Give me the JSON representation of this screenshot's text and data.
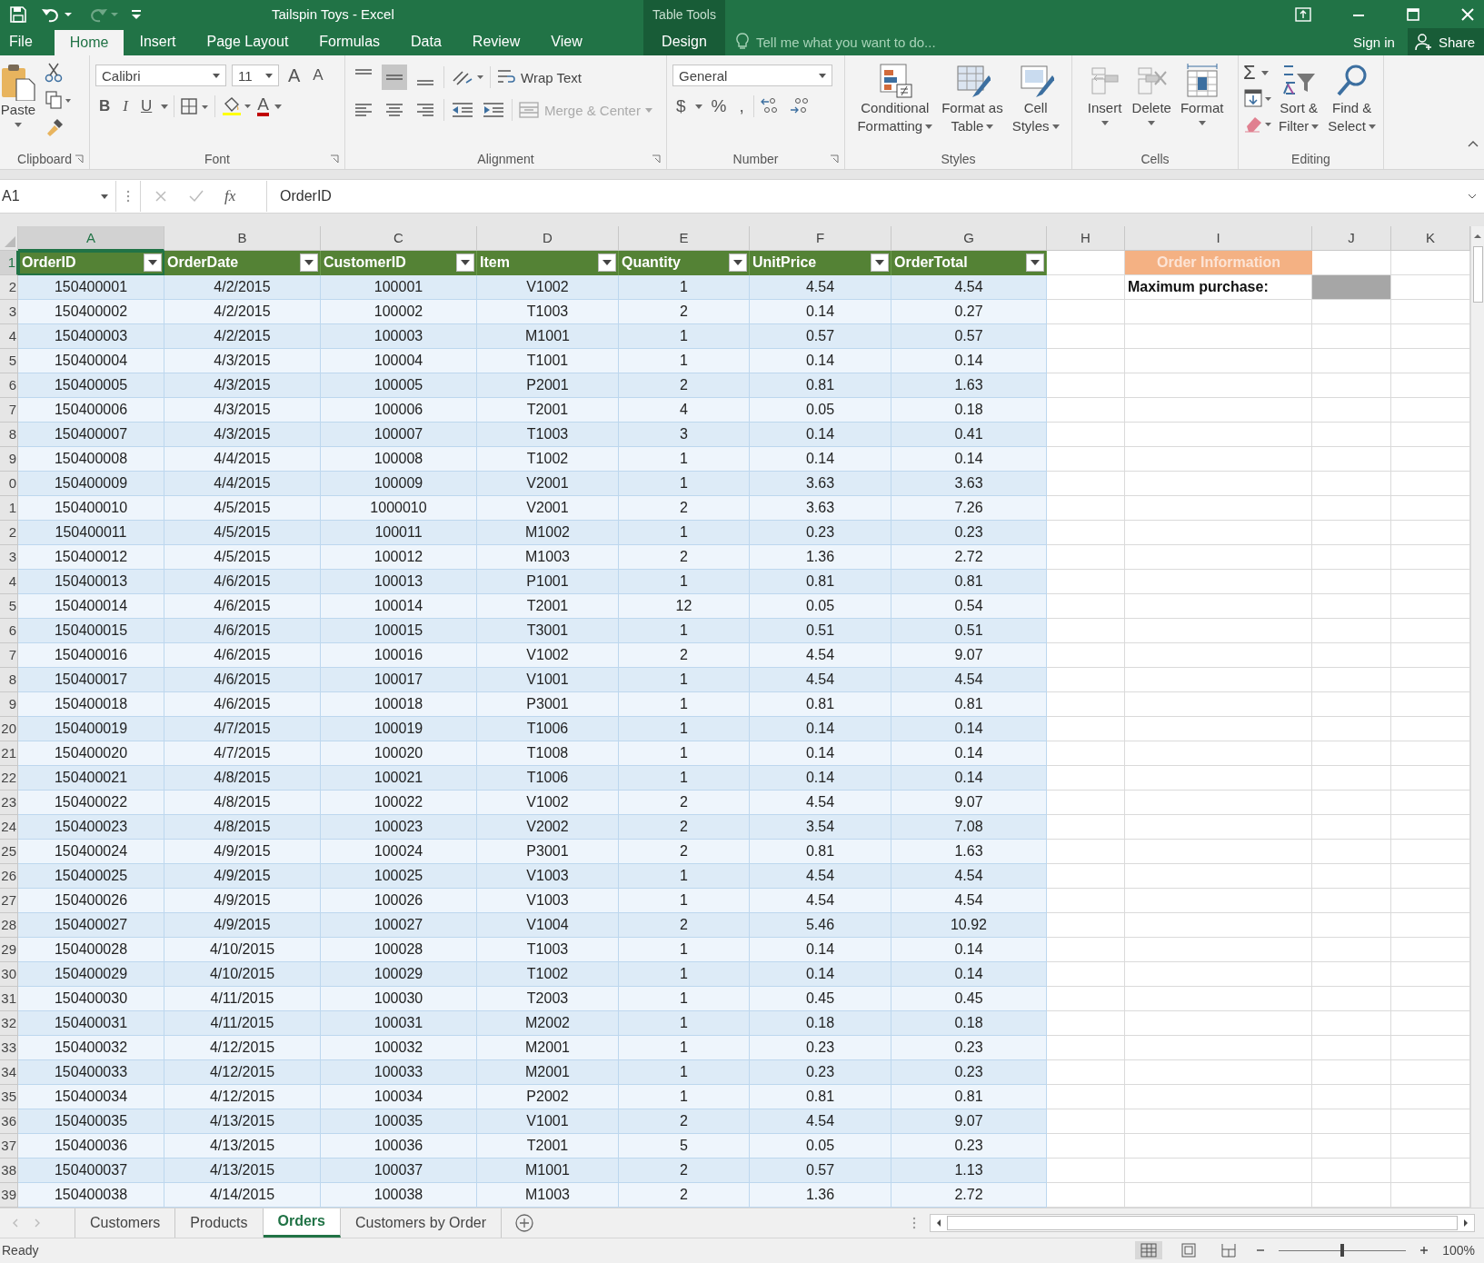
{
  "window": {
    "title": "Tailspin Toys - Excel",
    "contextual_group": "Table Tools"
  },
  "ribbon_tabs": [
    {
      "label": "File",
      "selected": false,
      "kind": "file"
    },
    {
      "label": "Home",
      "selected": true,
      "kind": "normal"
    },
    {
      "label": "Insert",
      "selected": false,
      "kind": "normal"
    },
    {
      "label": "Page Layout",
      "selected": false,
      "kind": "normal"
    },
    {
      "label": "Formulas",
      "selected": false,
      "kind": "normal"
    },
    {
      "label": "Data",
      "selected": false,
      "kind": "normal"
    },
    {
      "label": "Review",
      "selected": false,
      "kind": "normal"
    },
    {
      "label": "View",
      "selected": false,
      "kind": "normal"
    },
    {
      "label": "Design",
      "selected": false,
      "kind": "contextual"
    }
  ],
  "tell_me": {
    "placeholder": "Tell me what you want to do..."
  },
  "account": {
    "sign_in": "Sign in",
    "share": "Share"
  },
  "ribbon": {
    "clipboard": {
      "label": "Clipboard",
      "paste": "Paste"
    },
    "font": {
      "label": "Font",
      "font_name": "Calibri",
      "font_size": "11",
      "grow": "A",
      "shrink": "A",
      "bold": "B",
      "italic": "I",
      "underline": "U",
      "font_color": "A"
    },
    "alignment": {
      "label": "Alignment",
      "wrap_text": "Wrap Text",
      "merge_center": "Merge & Center",
      "merge_disabled": true
    },
    "number": {
      "label": "Number",
      "format": "General",
      "currency": "$",
      "percent": "%",
      "comma": ","
    },
    "styles": {
      "label": "Styles",
      "buttons": [
        {
          "lines": [
            "Conditional",
            "Formatting"
          ],
          "kind": "conditional"
        },
        {
          "lines": [
            "Format as",
            "Table"
          ],
          "kind": "table"
        },
        {
          "lines": [
            "Cell",
            "Styles"
          ],
          "kind": "cellstyles"
        }
      ]
    },
    "cells": {
      "label": "Cells",
      "buttons": [
        {
          "lines": [
            "Insert"
          ],
          "kind": "insert"
        },
        {
          "lines": [
            "Delete"
          ],
          "kind": "delete"
        },
        {
          "lines": [
            "Format"
          ],
          "kind": "format"
        }
      ]
    },
    "editing": {
      "label": "Editing",
      "autosum": "Σ",
      "buttons": [
        {
          "lines": [
            "Sort &",
            "Filter"
          ],
          "kind": "sort"
        },
        {
          "lines": [
            "Find &",
            "Select"
          ],
          "kind": "find"
        }
      ]
    }
  },
  "formula_bar": {
    "name_box": "A1",
    "fx": "fx",
    "formula": "OrderID"
  },
  "column_headers": [
    {
      "label": "A",
      "selected": true
    },
    {
      "label": "B",
      "selected": false
    },
    {
      "label": "C",
      "selected": false
    },
    {
      "label": "D",
      "selected": false
    },
    {
      "label": "E",
      "selected": false
    },
    {
      "label": "F",
      "selected": false
    },
    {
      "label": "G",
      "selected": false
    },
    {
      "label": "H",
      "selected": false
    },
    {
      "label": "I",
      "selected": false
    },
    {
      "label": "J",
      "selected": false
    },
    {
      "label": "K",
      "selected": false
    }
  ],
  "table": {
    "columns": [
      "OrderID",
      "OrderDate",
      "CustomerID",
      "Item",
      "Quantity",
      "UnitPrice",
      "OrderTotal"
    ],
    "rows": [
      {
        "row": "2",
        "cells": [
          "150400001",
          "4/2/2015",
          "100001",
          "V1002",
          "1",
          "4.54",
          "4.54"
        ]
      },
      {
        "row": "3",
        "cells": [
          "150400002",
          "4/2/2015",
          "100002",
          "T1003",
          "2",
          "0.14",
          "0.27"
        ]
      },
      {
        "row": "4",
        "cells": [
          "150400003",
          "4/2/2015",
          "100003",
          "M1001",
          "1",
          "0.57",
          "0.57"
        ]
      },
      {
        "row": "5",
        "cells": [
          "150400004",
          "4/3/2015",
          "100004",
          "T1001",
          "1",
          "0.14",
          "0.14"
        ]
      },
      {
        "row": "6",
        "cells": [
          "150400005",
          "4/3/2015",
          "100005",
          "P2001",
          "2",
          "0.81",
          "1.63"
        ]
      },
      {
        "row": "7",
        "cells": [
          "150400006",
          "4/3/2015",
          "100006",
          "T2001",
          "4",
          "0.05",
          "0.18"
        ]
      },
      {
        "row": "8",
        "cells": [
          "150400007",
          "4/3/2015",
          "100007",
          "T1003",
          "3",
          "0.14",
          "0.41"
        ]
      },
      {
        "row": "9",
        "cells": [
          "150400008",
          "4/4/2015",
          "100008",
          "T1002",
          "1",
          "0.14",
          "0.14"
        ]
      },
      {
        "row": "0",
        "cells": [
          "150400009",
          "4/4/2015",
          "100009",
          "V2001",
          "1",
          "3.63",
          "3.63"
        ]
      },
      {
        "row": "1",
        "cells": [
          "150400010",
          "4/5/2015",
          "1000010",
          "V2001",
          "2",
          "3.63",
          "7.26"
        ]
      },
      {
        "row": "2",
        "cells": [
          "150400011",
          "4/5/2015",
          "100011",
          "M1002",
          "1",
          "0.23",
          "0.23"
        ]
      },
      {
        "row": "3",
        "cells": [
          "150400012",
          "4/5/2015",
          "100012",
          "M1003",
          "2",
          "1.36",
          "2.72"
        ]
      },
      {
        "row": "4",
        "cells": [
          "150400013",
          "4/6/2015",
          "100013",
          "P1001",
          "1",
          "0.81",
          "0.81"
        ]
      },
      {
        "row": "5",
        "cells": [
          "150400014",
          "4/6/2015",
          "100014",
          "T2001",
          "12",
          "0.05",
          "0.54"
        ]
      },
      {
        "row": "6",
        "cells": [
          "150400015",
          "4/6/2015",
          "100015",
          "T3001",
          "1",
          "0.51",
          "0.51"
        ]
      },
      {
        "row": "7",
        "cells": [
          "150400016",
          "4/6/2015",
          "100016",
          "V1002",
          "2",
          "4.54",
          "9.07"
        ]
      },
      {
        "row": "8",
        "cells": [
          "150400017",
          "4/6/2015",
          "100017",
          "V1001",
          "1",
          "4.54",
          "4.54"
        ]
      },
      {
        "row": "9",
        "cells": [
          "150400018",
          "4/6/2015",
          "100018",
          "P3001",
          "1",
          "0.81",
          "0.81"
        ]
      },
      {
        "row": "20",
        "cells": [
          "150400019",
          "4/7/2015",
          "100019",
          "T1006",
          "1",
          "0.14",
          "0.14"
        ]
      },
      {
        "row": "21",
        "cells": [
          "150400020",
          "4/7/2015",
          "100020",
          "T1008",
          "1",
          "0.14",
          "0.14"
        ]
      },
      {
        "row": "22",
        "cells": [
          "150400021",
          "4/8/2015",
          "100021",
          "T1006",
          "1",
          "0.14",
          "0.14"
        ]
      },
      {
        "row": "23",
        "cells": [
          "150400022",
          "4/8/2015",
          "100022",
          "V1002",
          "2",
          "4.54",
          "9.07"
        ]
      },
      {
        "row": "24",
        "cells": [
          "150400023",
          "4/8/2015",
          "100023",
          "V2002",
          "2",
          "3.54",
          "7.08"
        ]
      },
      {
        "row": "25",
        "cells": [
          "150400024",
          "4/9/2015",
          "100024",
          "P3001",
          "2",
          "0.81",
          "1.63"
        ]
      },
      {
        "row": "26",
        "cells": [
          "150400025",
          "4/9/2015",
          "100025",
          "V1003",
          "1",
          "4.54",
          "4.54"
        ]
      },
      {
        "row": "27",
        "cells": [
          "150400026",
          "4/9/2015",
          "100026",
          "V1003",
          "1",
          "4.54",
          "4.54"
        ]
      },
      {
        "row": "28",
        "cells": [
          "150400027",
          "4/9/2015",
          "100027",
          "V1004",
          "2",
          "5.46",
          "10.92"
        ]
      },
      {
        "row": "29",
        "cells": [
          "150400028",
          "4/10/2015",
          "100028",
          "T1003",
          "1",
          "0.14",
          "0.14"
        ]
      },
      {
        "row": "30",
        "cells": [
          "150400029",
          "4/10/2015",
          "100029",
          "T1002",
          "1",
          "0.14",
          "0.14"
        ]
      },
      {
        "row": "31",
        "cells": [
          "150400030",
          "4/11/2015",
          "100030",
          "T2003",
          "1",
          "0.45",
          "0.45"
        ]
      },
      {
        "row": "32",
        "cells": [
          "150400031",
          "4/11/2015",
          "100031",
          "M2002",
          "1",
          "0.18",
          "0.18"
        ]
      },
      {
        "row": "33",
        "cells": [
          "150400032",
          "4/12/2015",
          "100032",
          "M2001",
          "1",
          "0.23",
          "0.23"
        ]
      },
      {
        "row": "34",
        "cells": [
          "150400033",
          "4/12/2015",
          "100033",
          "M2001",
          "1",
          "0.23",
          "0.23"
        ]
      },
      {
        "row": "35",
        "cells": [
          "150400034",
          "4/12/2015",
          "100034",
          "P2002",
          "1",
          "0.81",
          "0.81"
        ]
      },
      {
        "row": "36",
        "cells": [
          "150400035",
          "4/13/2015",
          "100035",
          "V1001",
          "2",
          "4.54",
          "9.07"
        ]
      },
      {
        "row": "37",
        "cells": [
          "150400036",
          "4/13/2015",
          "100036",
          "T2001",
          "5",
          "0.05",
          "0.23"
        ]
      },
      {
        "row": "38",
        "cells": [
          "150400037",
          "4/13/2015",
          "100037",
          "M1001",
          "2",
          "0.57",
          "1.13"
        ]
      },
      {
        "row": "39",
        "cells": [
          "150400038",
          "4/14/2015",
          "100038",
          "M1003",
          "2",
          "1.36",
          "2.72"
        ]
      }
    ]
  },
  "header_row": {
    "row": "1",
    "selected": true
  },
  "order_info": {
    "title": "Order Information",
    "label": "Maximum purchase:"
  },
  "sheet_tabs": [
    {
      "label": "Customers",
      "selected": false
    },
    {
      "label": "Products",
      "selected": false
    },
    {
      "label": "Orders",
      "selected": true
    },
    {
      "label": "Customers by Order",
      "selected": false
    }
  ],
  "status_bar": {
    "status": "Ready",
    "zoom": "100%",
    "zoom_slider": {
      "level": 0.5
    }
  }
}
